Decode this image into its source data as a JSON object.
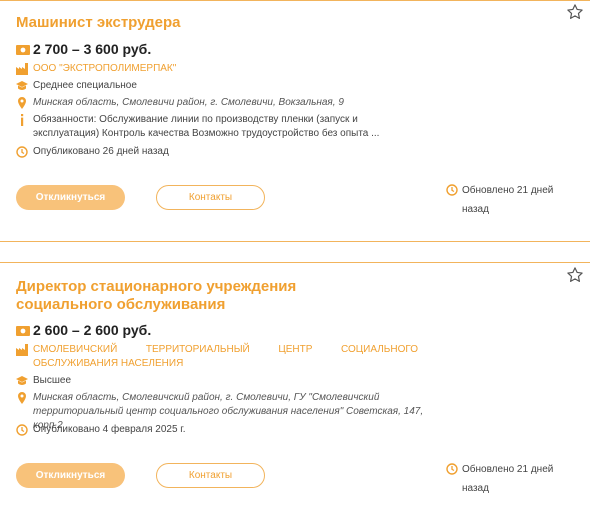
{
  "vacancies": [
    {
      "title": "Машинист экструдера",
      "salary": "2 700 – 3 600 руб.",
      "company": "ООО \"ЭКСТРОПОЛИМЕРПАК\"",
      "education": "Среднее специальное",
      "address": "Минская область, Смолевичи район, г. Смолевичи, Вокзальная, 9",
      "duties": "Обязанности: Обслуживание линии по производству пленки (запуск и эксплуатация) Контроль качества Возможно трудоустройство без опыта ...",
      "published": "Опубликовано 26 дней назад",
      "apply_label": "Откликнуться",
      "contacts_label": "Контакты",
      "updated": "Обновлено 21 дней назад"
    },
    {
      "title": "Директор стационарного учреждения социального обслуживания",
      "salary": "2 600 – 2 600 руб.",
      "company": "СМОЛЕВИЧСКИЙ ТЕРРИТОРИАЛЬНЫЙ ЦЕНТР СОЦИАЛЬНОГО ОБСЛУЖИВАНИЯ НАСЕЛЕНИЯ",
      "education": "Высшее",
      "address": "Минская область, Смолевичский район, г. Смолевичи, ГУ \"Смолевичский территориальный центр социального обслуживания населения\" Советская, 147, корп.2",
      "published": "Опубликовано 4 февраля 2025 г.",
      "apply_label": "Откликнуться",
      "contacts_label": "Контакты",
      "updated": "Обновлено 21 дней назад"
    }
  ],
  "colors": {
    "accent": "#f0a030",
    "button": "#f8c27a",
    "rule": "#f2b45c"
  }
}
